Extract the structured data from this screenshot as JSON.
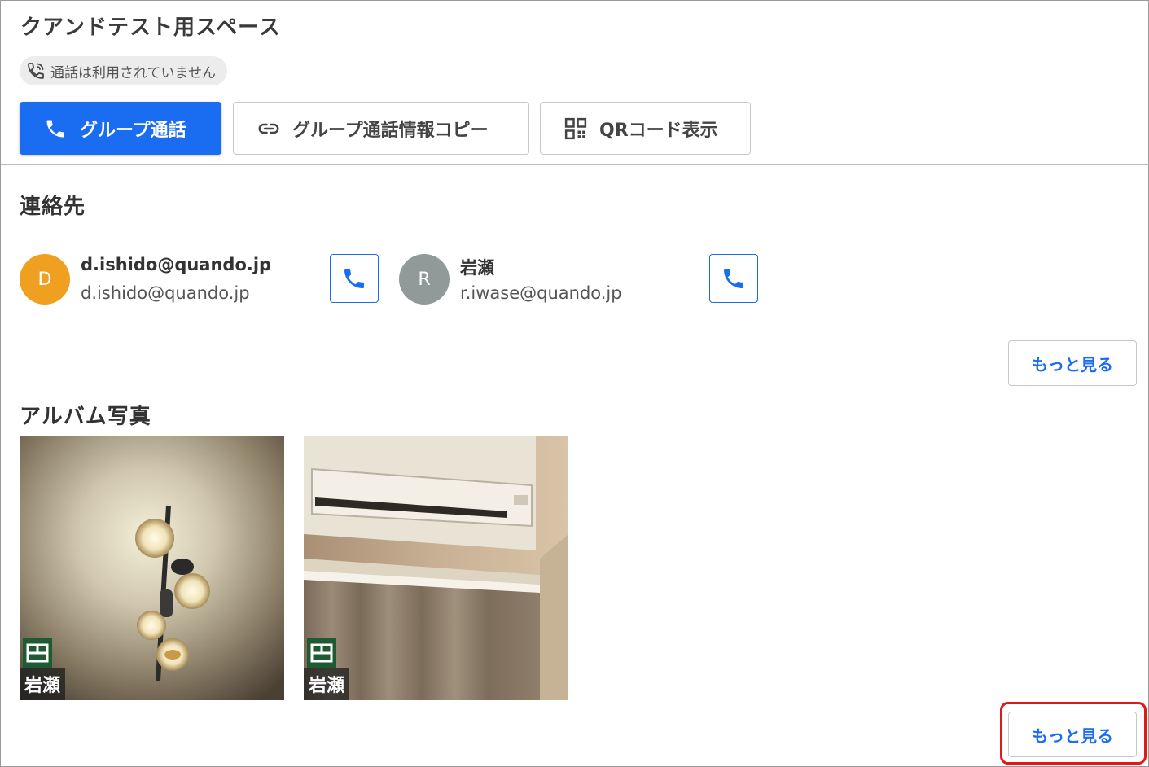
{
  "space": {
    "title": "クアンドテスト用スペース",
    "call_status": "通話は利用されていません"
  },
  "actions": {
    "group_call": "グループ通話",
    "copy_info": "グループ通話情報コピー",
    "show_qr": "QRコード表示"
  },
  "contacts": {
    "title": "連絡先",
    "items": [
      {
        "initial": "D",
        "name": "d.ishido@quando.jp",
        "email": "d.ishido@quando.jp",
        "avatar_color": "#f0a020"
      },
      {
        "initial": "R",
        "name": "岩瀬",
        "email": "r.iwase@quando.jp",
        "avatar_color": "#8f9a99"
      }
    ],
    "more_label": "もっと見る"
  },
  "album": {
    "title": "アルバム写真",
    "photos": [
      {
        "author": "岩瀬",
        "subject": "ceiling-light"
      },
      {
        "author": "岩瀬",
        "subject": "air-conditioner"
      }
    ],
    "more_label": "もっと見る"
  },
  "colors": {
    "accent": "#1a6cf0",
    "highlight": "#e01818",
    "badge": "#1e5a32"
  }
}
